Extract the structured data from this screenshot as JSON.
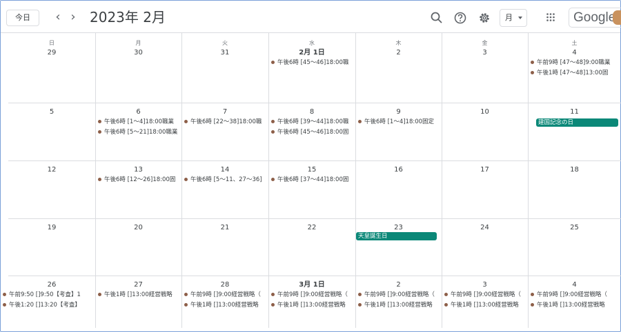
{
  "header": {
    "today_label": "今日",
    "prev_icon": "chevron-left-icon",
    "next_icon": "chevron-right-icon",
    "month_title": "2023年 2月",
    "view_label": "月",
    "brand_text": "Google"
  },
  "icons": {
    "search": "search-icon",
    "help": "help-icon",
    "settings": "gear-icon",
    "apps": "apps-grid-icon"
  },
  "colors": {
    "event_dot": "#8d5f49",
    "holiday_bg": "#0b8878",
    "grid_line": "#dadce0"
  },
  "weekdays": [
    "日",
    "月",
    "火",
    "水",
    "木",
    "金",
    "土"
  ],
  "weeks": [
    [
      {
        "label": "29",
        "events": []
      },
      {
        "label": "30",
        "events": []
      },
      {
        "label": "31",
        "events": []
      },
      {
        "label": "2月 1日",
        "events": [
          "午後6時 [45〜46]18:00職"
        ]
      },
      {
        "label": "2",
        "events": []
      },
      {
        "label": "3",
        "events": []
      },
      {
        "label": "4",
        "events": [
          "午前9時 [47〜48]9:00職業",
          "午後1時 [47〜48]13:00固"
        ]
      }
    ],
    [
      {
        "label": "5",
        "events": []
      },
      {
        "label": "6",
        "events": [
          "午後6時 [1〜4]18:00職業",
          "午後6時 [5〜21]18:00職業"
        ]
      },
      {
        "label": "7",
        "events": [
          "午後6時 [22〜38]18:00職"
        ]
      },
      {
        "label": "8",
        "events": [
          "午後6時 [39〜44]18:00職",
          "午後6時 [45〜46]18:00固"
        ]
      },
      {
        "label": "9",
        "events": [
          "午後6時 [1〜4]18:00固定"
        ]
      },
      {
        "label": "10",
        "events": []
      },
      {
        "label": "11",
        "events": [],
        "holiday": "建国記念の日"
      }
    ],
    [
      {
        "label": "12",
        "events": []
      },
      {
        "label": "13",
        "events": [
          "午後6時 [12〜26]18:00固"
        ]
      },
      {
        "label": "14",
        "events": [
          "午後6時 [5〜11、27〜36]"
        ]
      },
      {
        "label": "15",
        "events": [
          "午後6時 [37〜44]18:00固"
        ]
      },
      {
        "label": "16",
        "events": []
      },
      {
        "label": "17",
        "events": []
      },
      {
        "label": "18",
        "events": []
      }
    ],
    [
      {
        "label": "19",
        "events": []
      },
      {
        "label": "20",
        "events": []
      },
      {
        "label": "21",
        "events": []
      },
      {
        "label": "22",
        "events": []
      },
      {
        "label": "23",
        "events": [],
        "holiday": "天皇誕生日"
      },
      {
        "label": "24",
        "events": []
      },
      {
        "label": "25",
        "events": []
      }
    ],
    [
      {
        "label": "26",
        "events": [
          "午前9:50 []9:50【考査】1",
          "午後1:20 []13:20【考査】"
        ]
      },
      {
        "label": "27",
        "events": [
          "午後1時 []13:00経営戦略"
        ]
      },
      {
        "label": "28",
        "events": [
          "午前9時 []9:00経営戦略（",
          "午後1時 []13:00経営戦略"
        ]
      },
      {
        "label": "3月 1日",
        "events": [
          "午前9時 []9:00経営戦略（",
          "午後1時 []13:00経営戦略"
        ]
      },
      {
        "label": "2",
        "events": [
          "午前9時 []9:00経営戦略（",
          "午後1時 []13:00経営戦略"
        ]
      },
      {
        "label": "3",
        "events": [
          "午前9時 []9:00経営戦略（",
          "午後1時 []13:00経営戦略"
        ]
      },
      {
        "label": "4",
        "events": [
          "午前9時 []9:00経営戦略（",
          "午後1時 []13:00経営戦略"
        ]
      }
    ]
  ]
}
